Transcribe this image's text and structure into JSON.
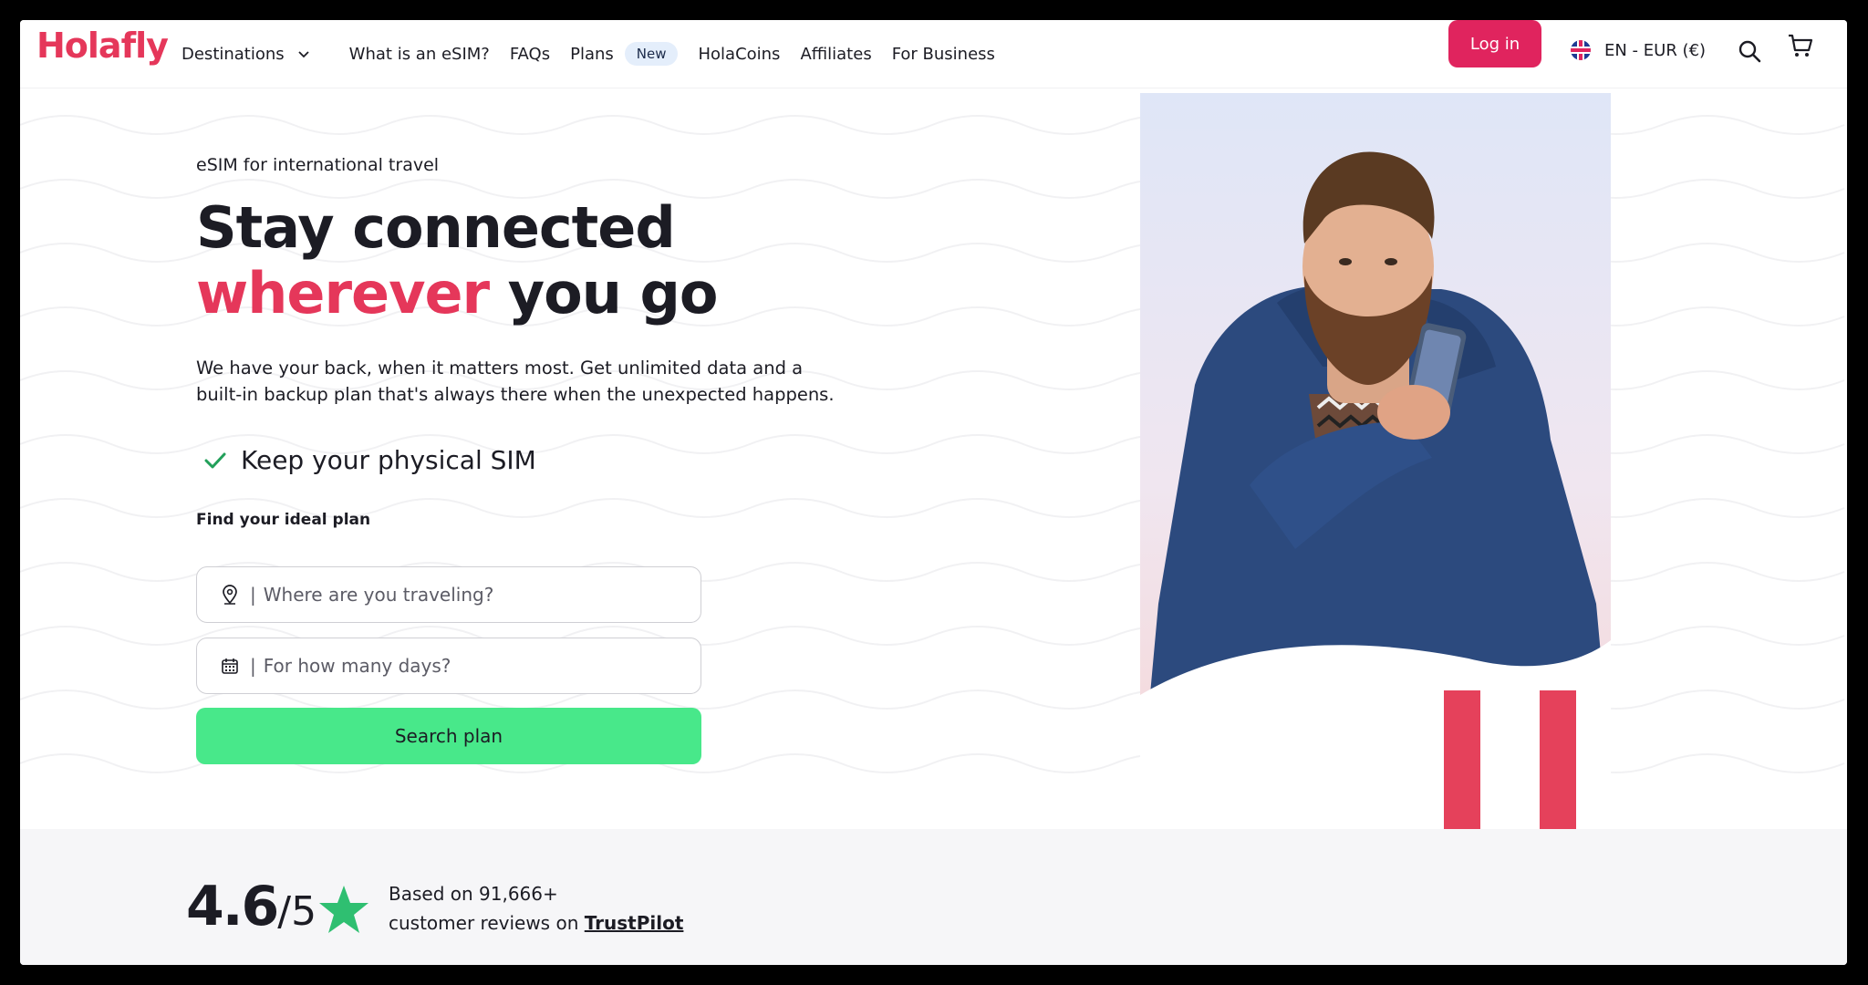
{
  "header": {
    "logo": "Holafly",
    "nav": [
      {
        "label": "Destinations"
      },
      {
        "label": "What is an eSIM?"
      },
      {
        "label": "FAQs"
      },
      {
        "label": "Plans",
        "badge": "New"
      },
      {
        "label": "HolaCoins"
      },
      {
        "label": "Affiliates"
      },
      {
        "label": "For Business"
      }
    ],
    "login_label": "Log in",
    "language": "EN - EUR (€)"
  },
  "hero": {
    "eyebrow": "eSIM for international travel",
    "title_line1": "Stay connected",
    "title_accent": "wherever",
    "title_rest": " you go",
    "lead": "We have your back, when it matters most. Get unlimited data and a built-in backup plan that's always there when the unexpected happens.",
    "feature": "Keep your physical SIM",
    "find_label": "Find your ideal plan",
    "destination_placeholder": "Where are you traveling?",
    "days_placeholder": "For how many days?",
    "search_label": "Search plan"
  },
  "rating": {
    "score": "4.6",
    "denominator": "/5",
    "line1": "Based on 91,666+",
    "line2_prefix": "customer reviews on ",
    "link": "TrustPilot"
  },
  "colors": {
    "brand": "#e5375a",
    "login": "#e0245e",
    "search_button": "#48e88a",
    "star": "#2fbf71"
  },
  "icons": [
    "chevron-down-icon",
    "flag-uk-icon",
    "search-icon",
    "cart-icon",
    "checkmark-icon",
    "location-pin-icon",
    "calendar-icon",
    "star-icon"
  ]
}
